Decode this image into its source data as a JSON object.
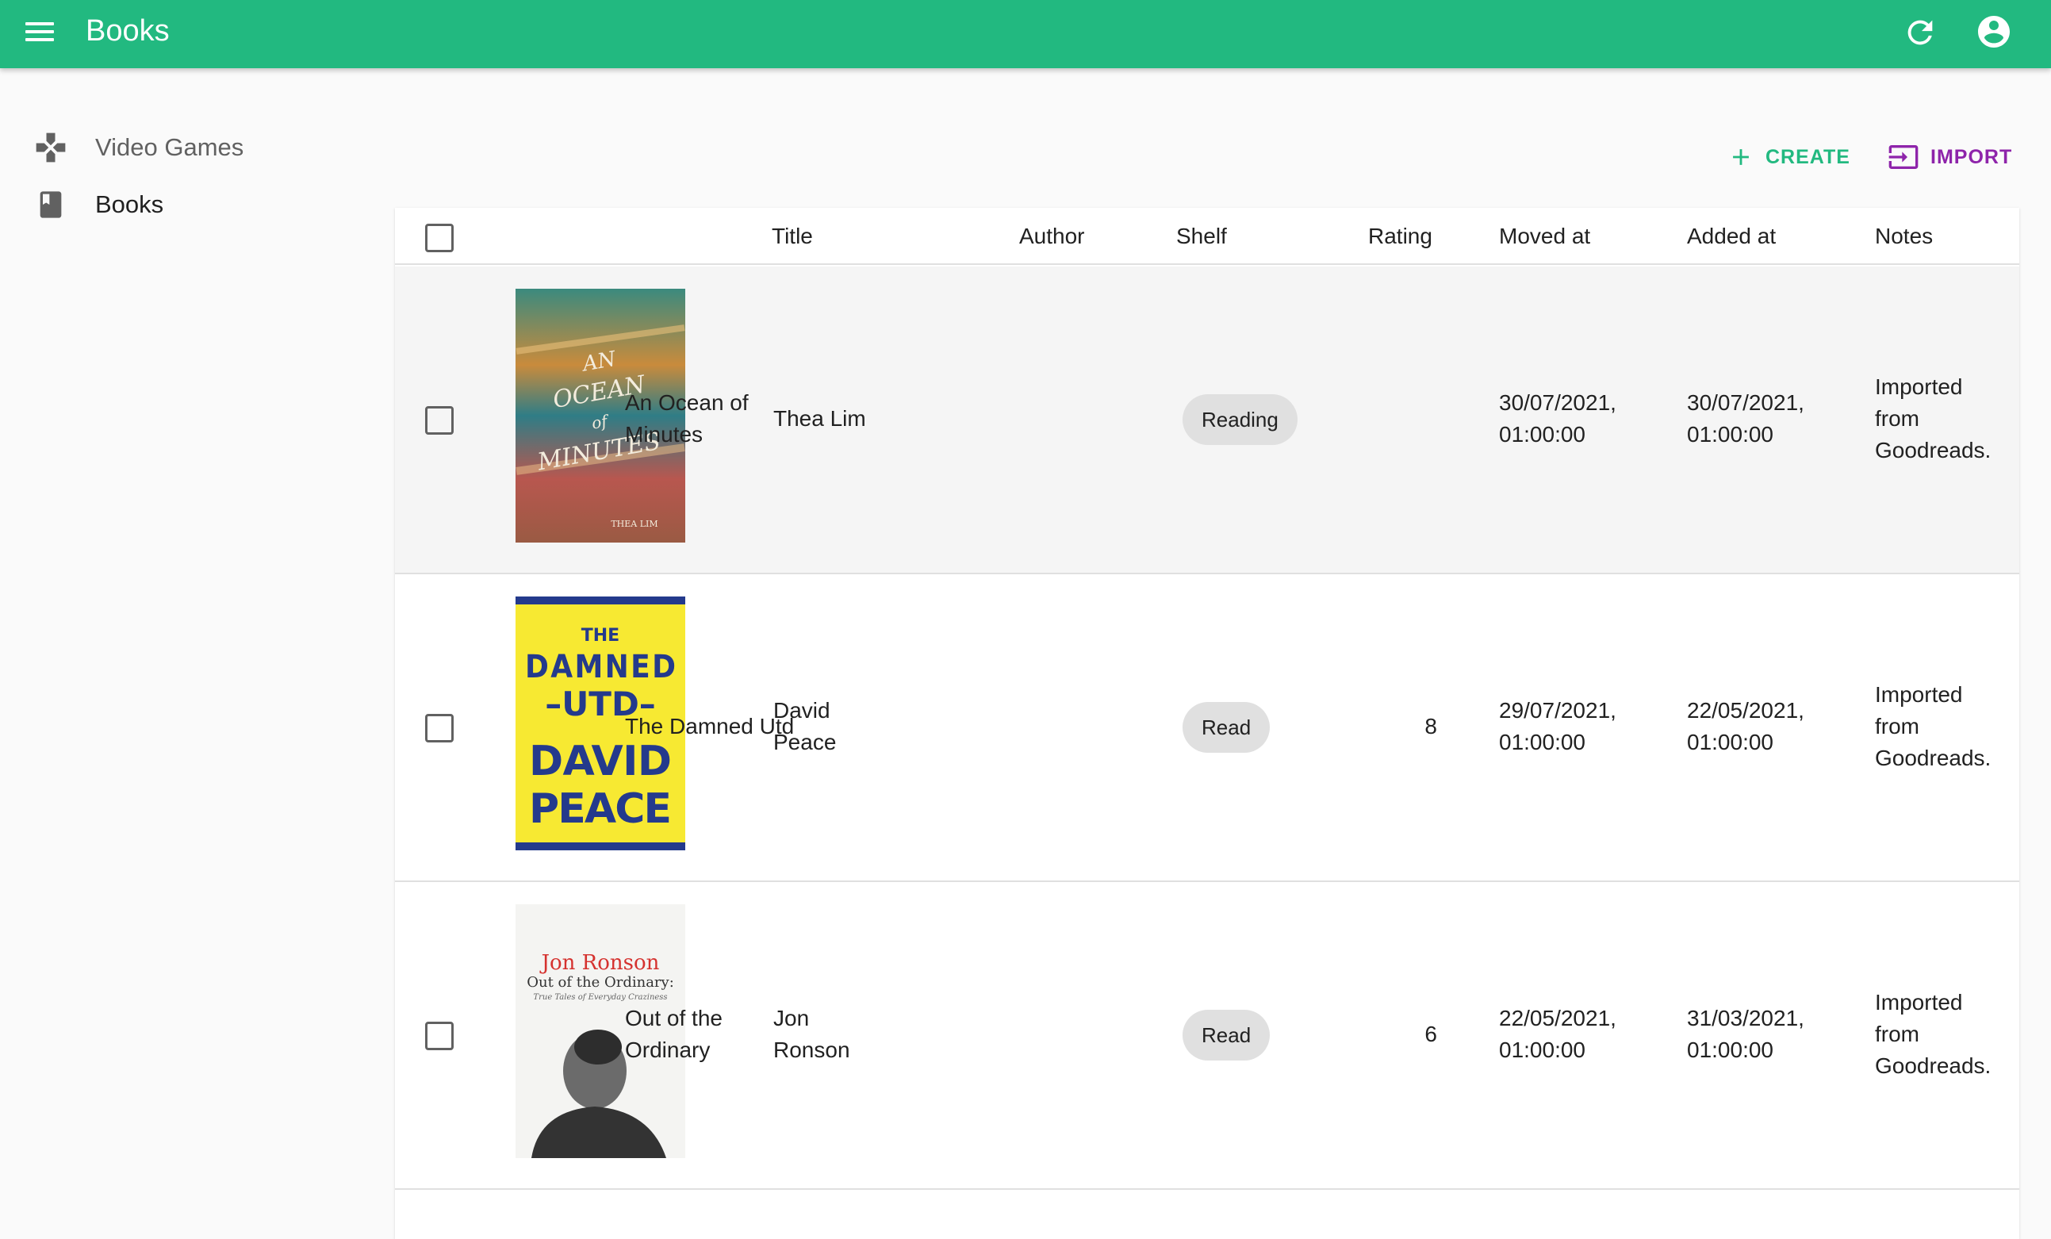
{
  "appbar": {
    "title": "Books",
    "color": "#22b980"
  },
  "sidebar": {
    "items": [
      {
        "label": "Video Games",
        "icon": "gamepad-icon"
      },
      {
        "label": "Books",
        "icon": "book-icon"
      }
    ]
  },
  "actions": {
    "create_label": "CREATE",
    "import_label": "IMPORT"
  },
  "table": {
    "headers": {
      "title": "Title",
      "author": "Author",
      "shelf": "Shelf",
      "rating": "Rating",
      "moved_at": "Moved at",
      "added_at": "Added at",
      "notes": "Notes"
    },
    "rows": [
      {
        "title_line1": "An Ocean of",
        "title_line2": "Minutes",
        "author_line1": "Thea Lim",
        "author_line2": "",
        "shelf": "Reading",
        "rating": "",
        "moved_line1": "30/07/2021,",
        "moved_line2": "01:00:00",
        "added_line1": "30/07/2021,",
        "added_line2": "01:00:00",
        "notes_line1": "Imported",
        "notes_line2": "from",
        "notes_line3": "Goodreads.",
        "cover": {
          "line1": "AN",
          "line2": "OCEAN",
          "line3": "of",
          "line4": "MINUTES",
          "author": "THEA LIM"
        }
      },
      {
        "title_line1": "The Damned Utd",
        "title_line2": "",
        "author_line1": "David",
        "author_line2": "Peace",
        "shelf": "Read",
        "rating": "8",
        "moved_line1": "29/07/2021,",
        "moved_line2": "01:00:00",
        "added_line1": "22/05/2021,",
        "added_line2": "01:00:00",
        "notes_line1": "Imported",
        "notes_line2": "from",
        "notes_line3": "Goodreads.",
        "cover": {
          "line1": "THE",
          "line2": "DAMNED",
          "line3": "–UTD–",
          "line4": "DAVID",
          "author": "PEACE"
        }
      },
      {
        "title_line1": "Out of the",
        "title_line2": "Ordinary",
        "author_line1": "Jon",
        "author_line2": "Ronson",
        "shelf": "Read",
        "rating": "6",
        "moved_line1": "22/05/2021,",
        "moved_line2": "01:00:00",
        "added_line1": "31/03/2021,",
        "added_line2": "01:00:00",
        "notes_line1": "Imported",
        "notes_line2": "from",
        "notes_line3": "Goodreads.",
        "cover": {
          "line1": "Jon Ronson",
          "line2": "Out of the Ordinary:",
          "line3": "True Tales of Everyday Craziness",
          "line4": "",
          "author": ""
        }
      }
    ]
  }
}
